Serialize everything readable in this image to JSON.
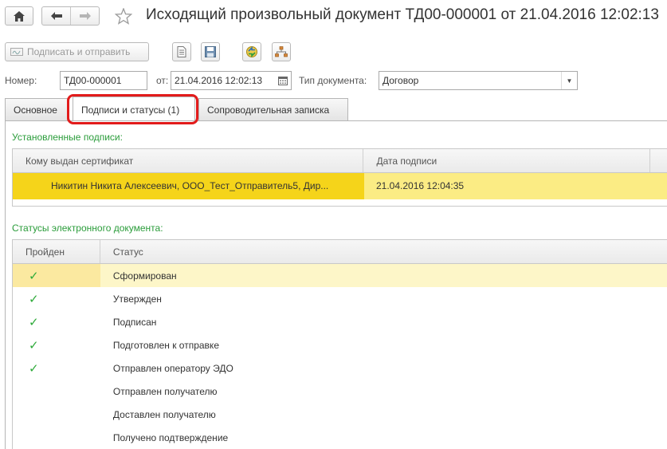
{
  "window": {
    "title": "Исходящий произвольный документ ТД00-000001 от 21.04.2016 12:02:13"
  },
  "toolbar": {
    "sign_send_label": "Подписать и отправить"
  },
  "fields": {
    "number_label": "Номер:",
    "number_value": "ТД00-000001",
    "date_label": "от:",
    "date_value": "21.04.2016 12:02:13",
    "type_label": "Тип документа:",
    "type_value": "Договор"
  },
  "tabs": [
    {
      "label": "Основное"
    },
    {
      "label": "Подписи и статусы (1)"
    },
    {
      "label": "Сопроводительная записка"
    }
  ],
  "signatures": {
    "section_title": "Установленные подписи:",
    "columns": [
      "Кому выдан сертификат",
      "Дата подписи"
    ],
    "rows": [
      {
        "holder": "Никитин Никита Алексеевич, ООО_Тест_Отправитель5, Дир...",
        "date": "21.04.2016 12:04:35"
      }
    ]
  },
  "statuses": {
    "section_title": "Статусы электронного документа:",
    "columns": [
      "Пройден",
      "Статус"
    ],
    "rows": [
      {
        "done": true,
        "status": "Сформирован"
      },
      {
        "done": true,
        "status": "Утвержден"
      },
      {
        "done": true,
        "status": "Подписан"
      },
      {
        "done": true,
        "status": "Подготовлен к отправке"
      },
      {
        "done": true,
        "status": "Отправлен оператору ЭДО"
      },
      {
        "done": false,
        "status": "Отправлен получателю"
      },
      {
        "done": false,
        "status": "Доставлен получателю"
      },
      {
        "done": false,
        "status": "Получено подтверждение"
      }
    ]
  },
  "colors": {
    "accent_green": "#2a9c3a",
    "highlight_red": "#e21b1b",
    "selection_yellow": "#f5d41a"
  },
  "icons": {
    "home": "home-icon",
    "back": "arrow-left-icon",
    "forward": "arrow-right-icon",
    "favorite": "star-icon",
    "check": "check-icon"
  }
}
